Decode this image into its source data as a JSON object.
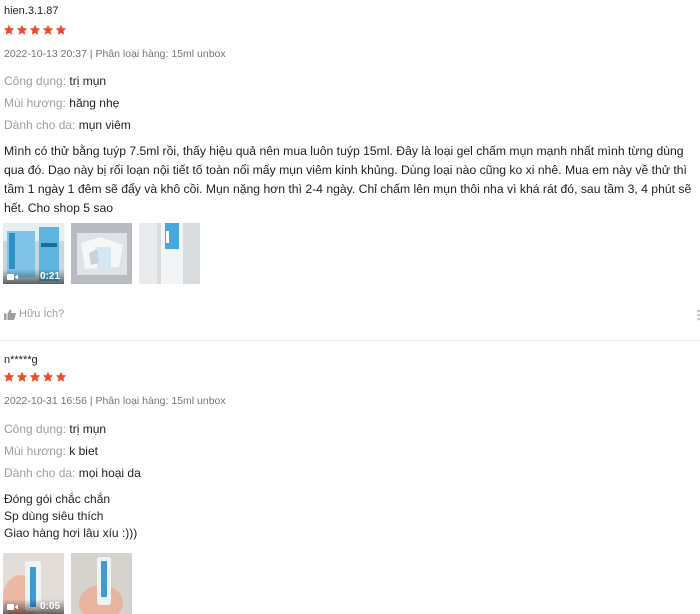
{
  "reviews": [
    {
      "username": "hien.3.1.87",
      "rating": 5,
      "meta": "2022-10-13 20:37 | Phân loại hàng: 15ml unbox",
      "attributes": [
        {
          "label": "Công dụng:",
          "value": "trị mụn"
        },
        {
          "label": "Mùi hương:",
          "value": "hăng nhẹ"
        },
        {
          "label": "Dành cho da:",
          "value": "mụn viêm"
        }
      ],
      "text": "Mình có thử bằng tuýp 7.5ml rồi, thấy hiệu quả nên mua luôn tuýp 15ml. Đây là loại gel chấm mụn mạnh nhất mình từng dùng qua đó. Dạo này bị rối loạn nội tiết tố toàn nổi mấy mụn viêm kinh khủng. Dùng loại nào cũng ko xi nhê. Mua em này về thử thì tầm 1 ngày 1 đêm sẽ đẩy và khô cồi. Mụn nặng hơn thì 2-4 ngày. Chỉ chấm lên mụn thôi nha vì khá rát đó, sau tầm 3, 4 phút sẽ hết. Cho shop 5 sao",
      "video_duration": "0:21",
      "helpful_label": "Hữu Ích?"
    },
    {
      "username": "n*****g",
      "rating": 5,
      "meta": "2022-10-31 16:56 | Phân loại hàng: 15ml unbox",
      "attributes": [
        {
          "label": "Công dụng:",
          "value": "trị mụn"
        },
        {
          "label": "Mùi hương:",
          "value": "k biet"
        },
        {
          "label": "Dành cho da:",
          "value": "mọi hoại da"
        }
      ],
      "text_lines": [
        "Đóng gói chắc chắn",
        "Sp dùng siêu thích",
        "Giao hàng hơi lâu xíu :)))"
      ],
      "video_duration": "0:05"
    }
  ],
  "colors": {
    "star": "#ee4d2d",
    "label": "#9e9e9e",
    "meta": "#757575"
  },
  "icons": [
    "star-icon",
    "video-camera-icon",
    "thumbs-up-icon",
    "more-options-icon"
  ]
}
